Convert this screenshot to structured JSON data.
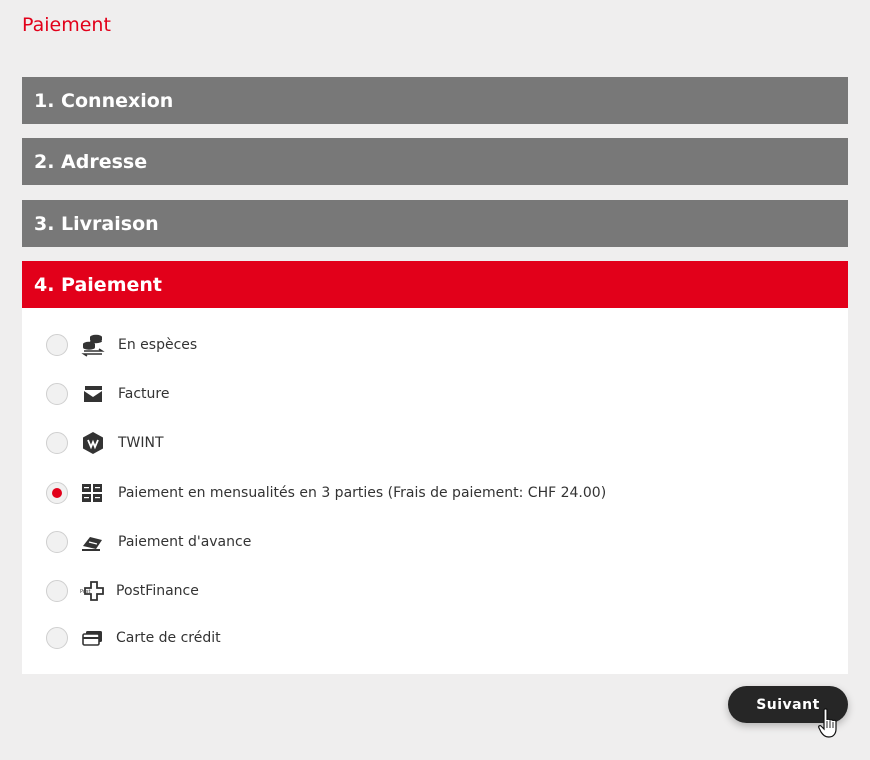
{
  "page_title": "Paiement",
  "steps": [
    {
      "label": "1. Connexion"
    },
    {
      "label": "2. Adresse"
    },
    {
      "label": "3. Livraison"
    },
    {
      "label": "4. Paiement"
    }
  ],
  "payment_options": [
    {
      "label": "En espèces",
      "icon": "cash-exchange-icon",
      "selected": false
    },
    {
      "label": "Facture",
      "icon": "invoice-icon",
      "selected": false
    },
    {
      "label": "TWINT",
      "icon": "twint-icon",
      "selected": false
    },
    {
      "label": "Paiement en mensualités en 3 parties (Frais de paiement: CHF 24.00)",
      "icon": "installments-icon",
      "selected": true
    },
    {
      "label": "Paiement d'avance",
      "icon": "advance-payment-icon",
      "selected": false
    },
    {
      "label": "PostFinance",
      "icon": "postfinance-icon",
      "selected": false
    },
    {
      "label": "Carte de crédit",
      "icon": "credit-card-icon",
      "selected": false
    }
  ],
  "next_button": "Suivant",
  "colors": {
    "accent": "#e2001a",
    "step_inactive": "#787878",
    "button": "#262626"
  }
}
